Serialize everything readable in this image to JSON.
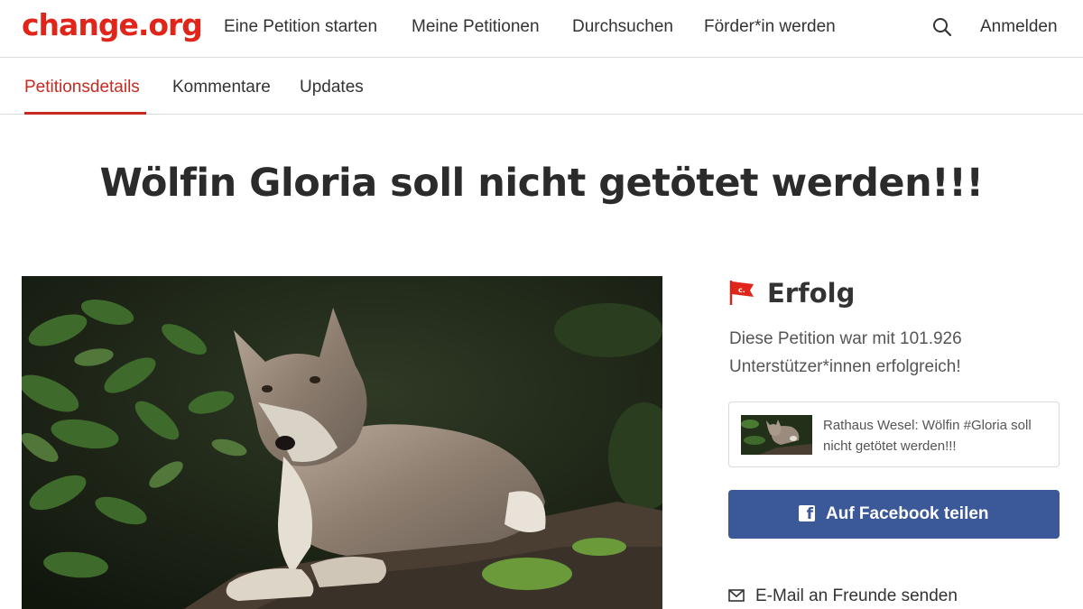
{
  "header": {
    "logo": "change.org",
    "nav": [
      "Eine Petition starten",
      "Meine Petitionen",
      "Durchsuchen",
      "Förder*in werden"
    ],
    "search_icon": "search-icon",
    "login": "Anmelden"
  },
  "tabs": [
    {
      "label": "Petitionsdetails",
      "active": true
    },
    {
      "label": "Kommentare",
      "active": false
    },
    {
      "label": "Updates",
      "active": false
    }
  ],
  "petition": {
    "title": "Wölfin Gloria soll nicht getötet werden!!!",
    "image": "wolf-photo"
  },
  "sidebar": {
    "status_icon": "flag-icon",
    "status": "Erfolg",
    "success_text": "Diese Petition war mit 101.926 Unterstützer*innen erfolgreich!",
    "share_card_text": "Rathaus Wesel: Wölfin #Gloria soll nicht getötet werden!!!",
    "facebook_button": "Auf Facebook teilen",
    "email_link": "E-Mail an Freunde senden"
  },
  "colors": {
    "brand": "#e0251b",
    "active_tab": "#c62a21",
    "facebook": "#3b5998"
  }
}
